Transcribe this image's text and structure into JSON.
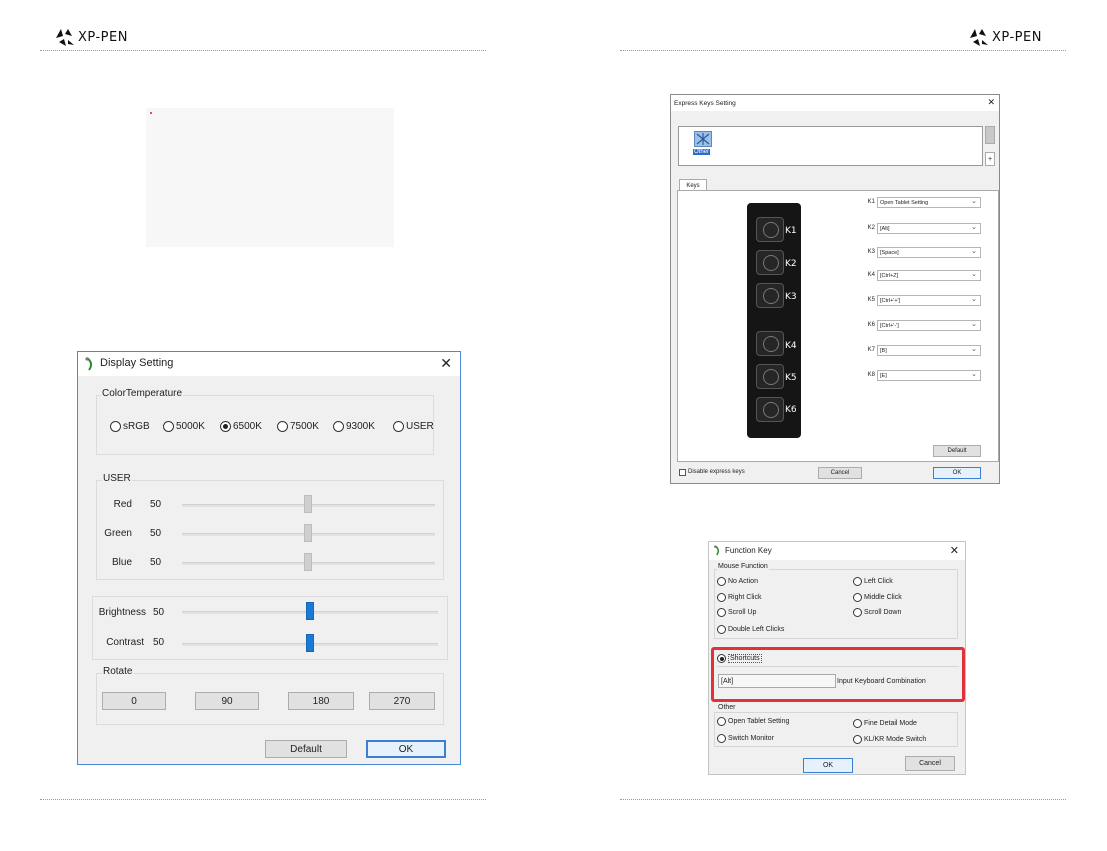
{
  "page_header": {
    "brand_left": "XP-PEN",
    "brand_right": "XP-PEN"
  },
  "display_setting": {
    "title": "Display Setting",
    "color_temperature": {
      "label": "ColorTemperature",
      "options": [
        "sRGB",
        "5000K",
        "6500K",
        "7500K",
        "9300K",
        "USER"
      ],
      "selected": "6500K"
    },
    "user": {
      "label": "USER",
      "red_label": "Red",
      "red_value": "50",
      "green_label": "Green",
      "green_value": "50",
      "blue_label": "Blue",
      "blue_value": "50"
    },
    "brightness_label": "Brightness",
    "brightness_value": "50",
    "contrast_label": "Contrast",
    "contrast_value": "50",
    "slider_levels": {
      "red": 0.5,
      "green": 0.5,
      "blue": 0.5,
      "brightness": 0.5,
      "contrast": 0.5
    },
    "rotate": {
      "label": "Rotate",
      "options": [
        "0",
        "90",
        "180",
        "270"
      ]
    },
    "default_button": "Default",
    "ok_button": "OK"
  },
  "express_keys": {
    "title": "Express Keys Setting",
    "app_label": "Other",
    "add_button": "+",
    "tab_keys": "Keys",
    "keys": [
      {
        "label": "K1",
        "value": "Open Tablet Setting"
      },
      {
        "label": "K2",
        "value": "[Alt]"
      },
      {
        "label": "K3",
        "value": "[Space]"
      },
      {
        "label": "K4",
        "value": "[Ctrl+Z]"
      },
      {
        "label": "K5",
        "value": "[Ctrl+'+']"
      },
      {
        "label": "K6",
        "value": "[Ctrl+'-']"
      },
      {
        "label": "K7",
        "value": "[B]"
      },
      {
        "label": "K8",
        "value": "[E]"
      }
    ],
    "device_keys": [
      "K1",
      "K2",
      "K3",
      "K4",
      "K5",
      "K6"
    ],
    "default_button": "Default",
    "disable_label": "Disable express keys",
    "cancel_button": "Cancel",
    "ok_button": "OK"
  },
  "function_key": {
    "title": "Function Key",
    "mouse_function_label": "Mouse Function",
    "mouse_options": {
      "no_action": "No Action",
      "left_click": "Left Click",
      "right_click": "Right Click",
      "middle_click": "Middle Click",
      "scroll_up": "Scroll Up",
      "scroll_down": "Scroll Down",
      "double_left": "Double Left Clicks"
    },
    "shortcuts_label": "Shortcuts",
    "shortcut_value": "[Alt]",
    "input_hint": "Input Keyboard Combination",
    "other_label": "Other",
    "other_options": {
      "open_tablet": "Open Tablet Setting",
      "fine_detail": "Fine Detail Mode",
      "switch_monitor": "Switch Monitor",
      "kl_kr": "KL/KR Mode Switch"
    },
    "ok_button": "OK",
    "cancel_button": "Cancel"
  },
  "colors": {
    "highlight_red": "#e2313b",
    "slider_blue": "#1b79d7",
    "window_border": "#4a8ad4"
  }
}
